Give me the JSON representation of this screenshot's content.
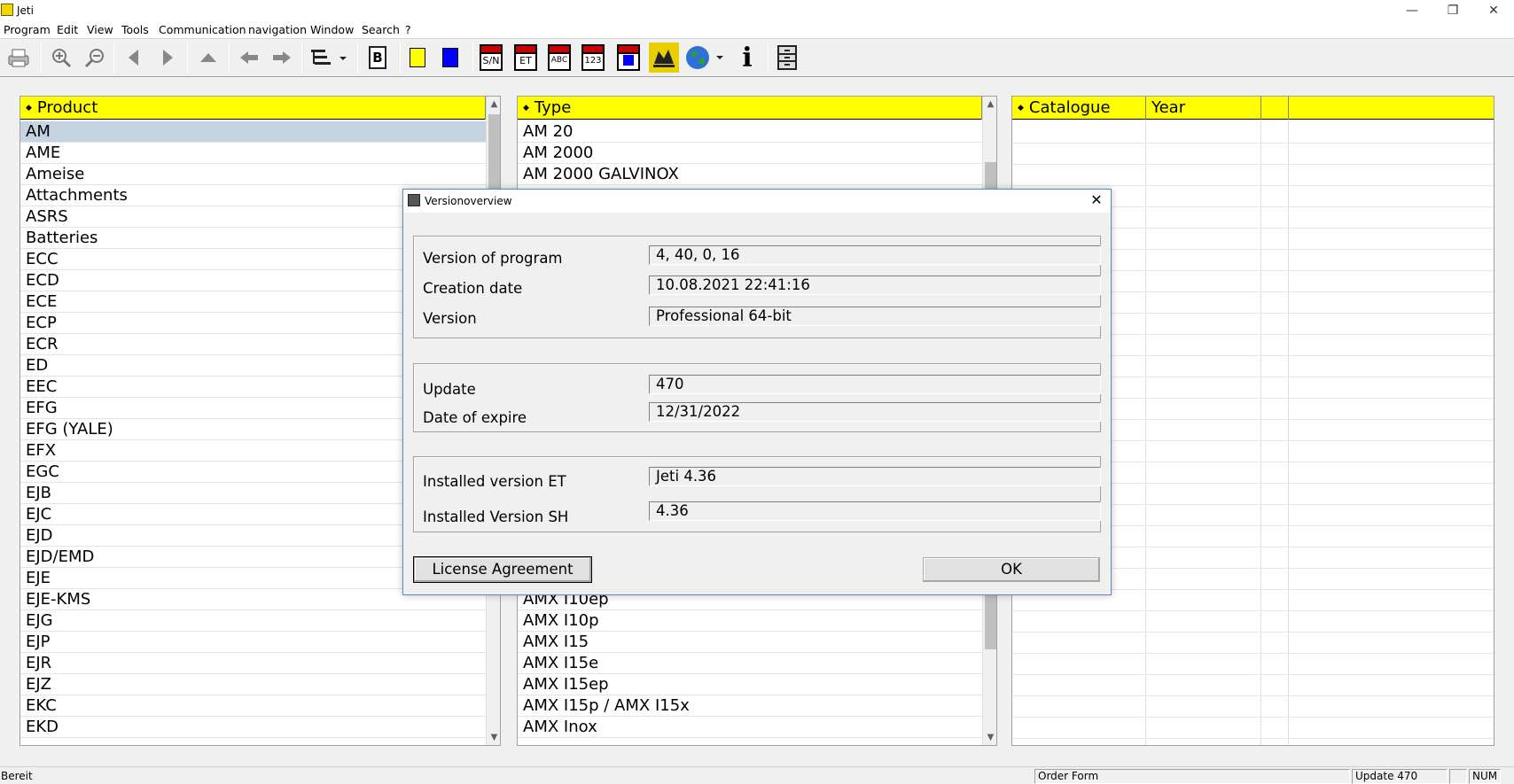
{
  "window": {
    "title": "Jeti",
    "minimize": "—",
    "restore": "❐",
    "close": "✕"
  },
  "menu": [
    "Program",
    "Edit",
    "View",
    "Tools",
    "Communication",
    "navigation",
    "Window",
    "Search",
    "?"
  ],
  "toolbar": {
    "sn_label": "S/N",
    "et_label": "ET",
    "abc_label": "ABC",
    "num_label": "123",
    "b_label": "B",
    "info_label": "i",
    "colors": {
      "yellow": "#ffff00",
      "blue": "#0000ff"
    }
  },
  "product_panel": {
    "header": "Product",
    "selected": "AM",
    "items": [
      "AM",
      "AME",
      "Ameise",
      "Attachments",
      "ASRS",
      "Batteries",
      "ECC",
      "ECD",
      "ECE",
      "ECP",
      "ECR",
      "ED",
      "EEC",
      "EFG",
      "EFG (YALE)",
      "EFX",
      "EGC",
      "EJB",
      "EJC",
      "EJD",
      "EJD/EMD",
      "EJE",
      "EJE-KMS",
      "EJG",
      "EJP",
      "EJR",
      "EJZ",
      "EKC",
      "EKD"
    ]
  },
  "type_panel": {
    "header": "Type",
    "items_top": [
      "AM 20",
      "AM 2000",
      "AM 2000 GALVINOX"
    ],
    "items_bottom": [
      "AMX I10ep",
      "AMX I10p",
      "AMX I15",
      "AMX I15e",
      "AMX I15ep",
      "AMX I15p / AMX I15x",
      "AMX Inox"
    ]
  },
  "catalogue_panel": {
    "col_catalogue": "Catalogue",
    "col_year": "Year"
  },
  "statusbar": {
    "ready": "Bereit",
    "order_form": "Order Form",
    "update": "Update 470",
    "num": "NUM"
  },
  "dialog": {
    "title": "Versionoverview",
    "close_glyph": "✕",
    "version_of_program_label": "Version of program",
    "version_of_program": "4, 40, 0, 16",
    "creation_date_label": "Creation date",
    "creation_date": "10.08.2021 22:41:16",
    "version_label": "Version",
    "version": "Professional 64-bit",
    "update_label": "Update",
    "update": "470",
    "date_of_expire_label": "Date of expire",
    "date_of_expire": "12/31/2022",
    "installed_et_label": "Installed version ET",
    "installed_et": "Jeti 4.36",
    "installed_sh_label": "Installed Version SH",
    "installed_sh": "4.36",
    "license_button": "License Agreement",
    "ok_button": "OK"
  }
}
